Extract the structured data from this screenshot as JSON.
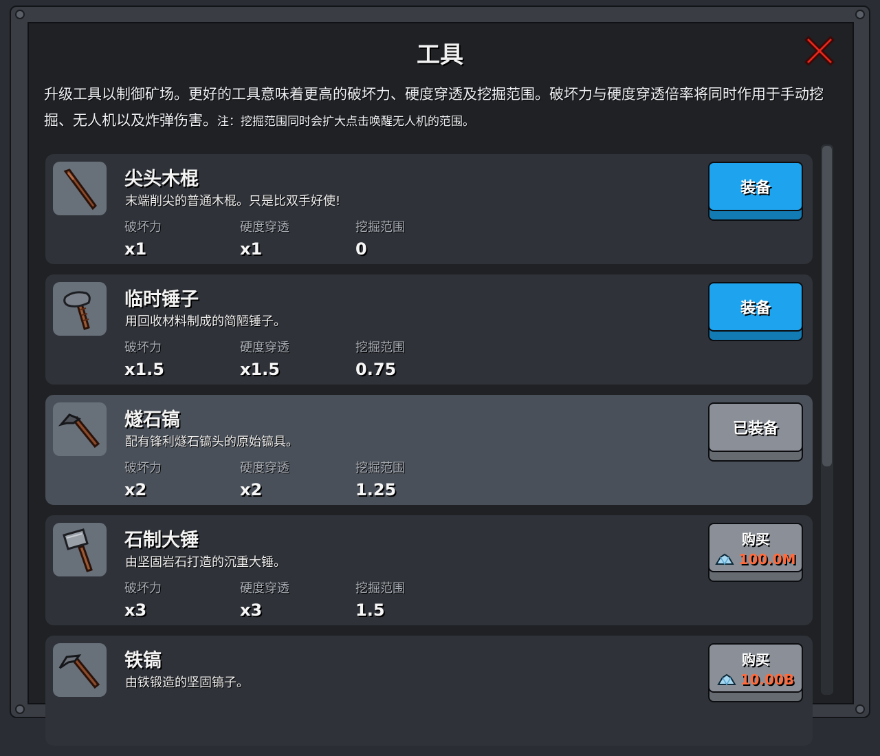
{
  "window": {
    "title": "工具",
    "description": "升级工具以制御矿场。更好的工具意味着更高的破坏力、硬度穿透及挖掘范围。破坏力与硬度穿透倍率将同时作用于手动挖掘、无人机以及炸弹伤害。",
    "note": "注：挖掘范围同时会扩大点击唤醒无人机的范围。"
  },
  "stat_labels": {
    "power": "破坏力",
    "pierce": "硬度穿透",
    "range": "挖掘范围"
  },
  "tools": [
    {
      "name": "尖头木棍",
      "desc": "末端削尖的普通木棍。只是比双手好使!",
      "power": "x1",
      "pierce": "x1",
      "range": "0",
      "button": "装备",
      "state": "equip",
      "icon": "stick-icon"
    },
    {
      "name": "临时锤子",
      "desc": "用回收材料制成的简陋锤子。",
      "power": "x1.5",
      "pierce": "x1.5",
      "range": "0.75",
      "button": "装备",
      "state": "equip",
      "icon": "makeshift-hammer-icon"
    },
    {
      "name": "燧石镐",
      "desc": "配有锋利燧石镐头的原始镐具。",
      "power": "x2",
      "pierce": "x2",
      "range": "1.25",
      "button": "已装备",
      "state": "equipped",
      "icon": "flint-pickaxe-icon"
    },
    {
      "name": "石制大锤",
      "desc": "由坚固岩石打造的沉重大锤。",
      "power": "x3",
      "pierce": "x3",
      "range": "1.5",
      "button": "购买",
      "price": "100.0M",
      "state": "buy",
      "icon": "stone-hammer-icon"
    },
    {
      "name": "铁镐",
      "desc": "由铁锻造的坚固镐子。",
      "power": "",
      "pierce": "",
      "range": "",
      "button": "购买",
      "price": "10.00B",
      "state": "buy",
      "icon": "iron-pickaxe-icon"
    }
  ],
  "colors": {
    "equip_button": "#1ea4ee",
    "equipped_button": "#8b9098",
    "price_text": "#ff6b3d",
    "close_icon": "#e8261c"
  }
}
